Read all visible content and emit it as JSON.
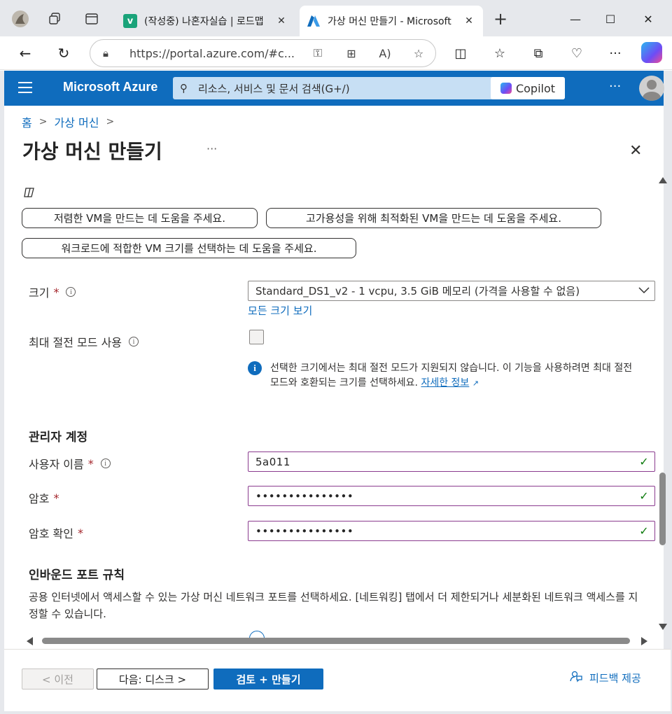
{
  "browser": {
    "tabs": [
      {
        "title": "(작성중) 나혼자실습 | 로드맵",
        "favicon": "v",
        "favicon_color": "#1aa37a"
      },
      {
        "title": "가상 머신 만들기 - Microsoft",
        "favicon": "A",
        "favicon_color": "#0f6cbd"
      }
    ],
    "new_tab": "+",
    "window_controls": {
      "minimize": "—",
      "maximize": "☐",
      "close": "✕"
    },
    "url": "https://portal.azure.com/#c..."
  },
  "azure": {
    "brand": "Microsoft Azure",
    "search_placeholder": "리소스, 서비스 및 문서 검색(G+/)",
    "copilot_label": "Copilot",
    "more": "···",
    "accent_color": "#0f6cbd"
  },
  "breadcrumb": [
    "홈",
    "가상 머신"
  ],
  "page": {
    "title": "가상 머신 만들기",
    "more": "···",
    "close": "✕"
  },
  "suggestions": [
    "저렴한 VM을 만드는 데 도움을 주세요.",
    "고가용성을 위해 최적화된 VM을 만드는 데 도움을 주세요.",
    "워크로드에 적합한 VM 크기를 선택하는 데 도움을 주세요."
  ],
  "form": {
    "size_label": "크기",
    "size_value": "Standard_DS1_v2 - 1 vcpu, 3.5 GiB 메모리 (가격을 사용할 수 없음)",
    "all_sizes_link": "모든 크기 보기",
    "hibernate_label": "최대 절전 모드 사용",
    "hibernate_note": "선택한 크기에서는 최대 절전 모드가 지원되지 않습니다. 이 기능을 사용하려면 최대 절전 모드와 호환되는 크기를 선택하세요.",
    "learn_more_link": "자세한 정보",
    "admin_section": "관리자 계정",
    "username_label": "사용자 이름",
    "username_value": "5a011",
    "password_label": "암호",
    "password_value": "•••••••••••••••",
    "confirm_label": "암호 확인",
    "confirm_value": "•••••••••••••••",
    "inbound_section": "인바운드 포트 규칙",
    "inbound_desc": "공용 인터넷에서 액세스할 수 있는 가상 머신 네트워크 포트를 선택하세요. [네트워킹] 탭에서 더 제한되거나 세분화된 네트워크 액세스를 지정할 수 있습니다."
  },
  "footer": {
    "prev": "< 이전",
    "next": "다음: 디스크 >",
    "create": "검토 + 만들기",
    "feedback": "피드백 제공"
  }
}
